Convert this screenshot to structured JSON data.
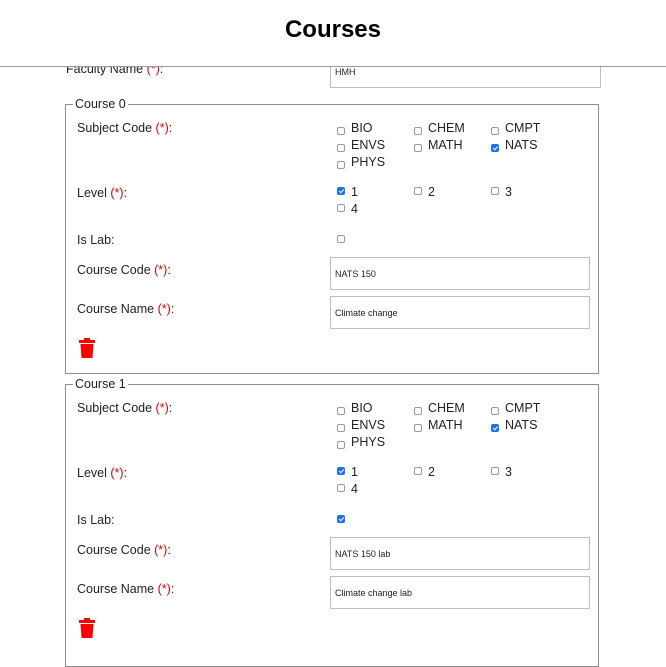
{
  "page_title": "Courses",
  "faculty": {
    "label": "Faculty Name",
    "value": "HMH"
  },
  "labels": {
    "subject_code": "Subject Code",
    "level": "Level",
    "is_lab": "Is Lab:",
    "course_code": "Course Code",
    "course_name": "Course Name",
    "required_mark": "(*):"
  },
  "subject_options": [
    "BIO",
    "CHEM",
    "CMPT",
    "ENVS",
    "MATH",
    "NATS",
    "PHYS"
  ],
  "level_options": [
    "1",
    "2",
    "3",
    "4"
  ],
  "courses": [
    {
      "legend": "Course 0",
      "subject_selected": "NATS",
      "level_selected": "1",
      "is_lab": false,
      "course_code": "NATS 150",
      "course_name": "Climate change"
    },
    {
      "legend": "Course 1",
      "subject_selected": "NATS",
      "level_selected": "1",
      "is_lab": true,
      "course_code": "NATS 150 lab",
      "course_name": "Climate change lab"
    }
  ],
  "colors": {
    "accent": "#1a73e8",
    "required": "#e00000",
    "delete": "#ff0000"
  },
  "icons": {
    "delete": "trash-icon"
  }
}
